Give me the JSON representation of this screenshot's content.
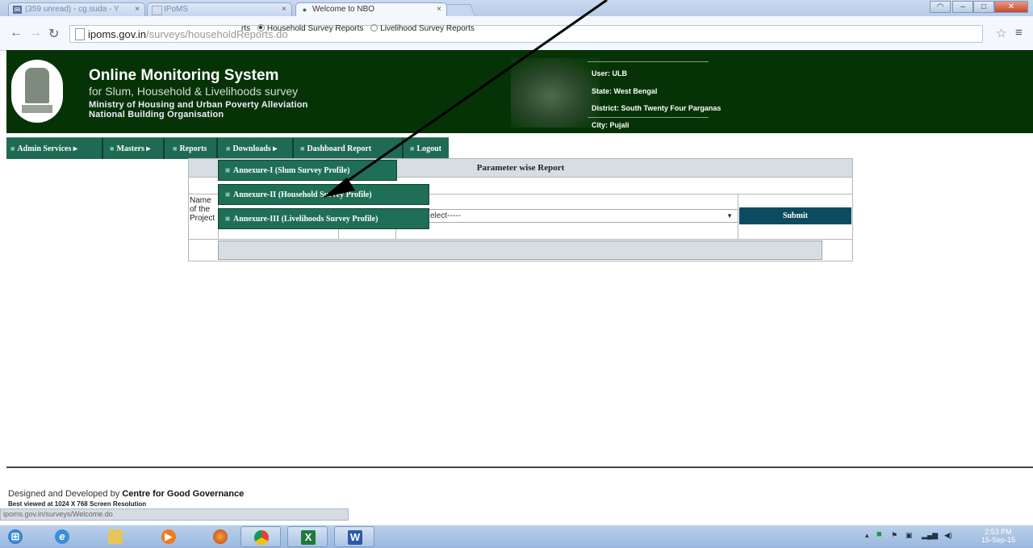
{
  "browser": {
    "tabs": [
      {
        "label": "(359 unread) - cg.suda - Y",
        "active": false
      },
      {
        "label": "IPoMS",
        "active": false
      },
      {
        "label": "Welcome to NBO",
        "active": true
      }
    ],
    "url_host": "ipoms.gov.in",
    "url_path": "/surveys/householdReports.do"
  },
  "header": {
    "title": "Online Monitoring System",
    "subtitle": "for Slum, Household & Livelihoods survey",
    "ministry": "Ministry of Housing and Urban Poverty Alleviation",
    "org": "National Building Organisation",
    "user": "User: ULB",
    "state": "State: West Bengal",
    "district": "District: South Twenty Four Parganas",
    "city": "City: Pujali"
  },
  "menu": {
    "items": [
      "Admin Services",
      "Masters",
      "Reports",
      "Downloads",
      "Dashboard Report",
      "Logout"
    ],
    "downloads_dropdown": [
      "Annexure-I (Slum Survey Profile)",
      "Annexure-II (Household Survey Profile)",
      "Annexure-III (Livelihoods Survey Profile)"
    ]
  },
  "report": {
    "heading": "Parameter wise Report",
    "radio_partial": "rts",
    "radio_household": "Household Survey Reports",
    "radio_livelihood": "Livelihood Survey Reports",
    "name_label": "Name of the Project",
    "select_value": "elect-----",
    "submit_label": "Submit"
  },
  "footer": {
    "designed_by": "Designed and Developed by",
    "designer": "Centre for Good Governance",
    "best_viewed": "Best viewed at 1024 X 768 Screen Resolution",
    "status_url": "ipoms.gov.in/surveys/Welcome.do"
  },
  "taskbar": {
    "clock_time": "2:53 PM",
    "clock_date": "15-Sep-15"
  },
  "colors": {
    "header_bg": "#063306",
    "menu_bg": "#1f6a53",
    "submit_bg": "#0d4c60"
  }
}
